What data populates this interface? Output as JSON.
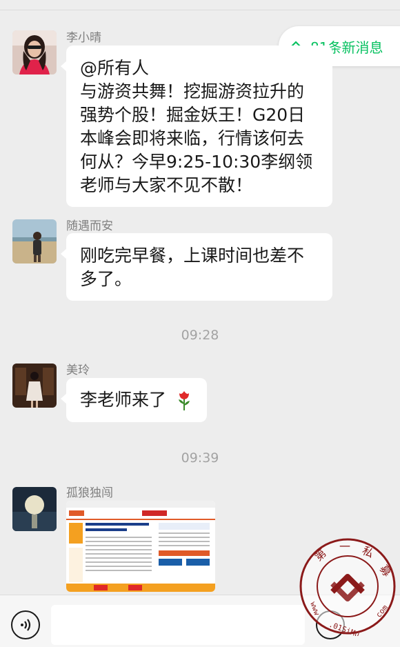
{
  "chat": {
    "new_messages": "81条新消息",
    "messages": [
      {
        "sender": "李小晴",
        "lines": [
          "@所有人",
          "与游资共舞！挖掘游资拉升的",
          "强势个股！掘金妖王！G20日",
          "本峰会即将来临，行情该何去",
          "何从？今早9:25-10:30李纲领",
          "老师与大家不见不散！"
        ]
      },
      {
        "sender": "随遇而安",
        "lines": [
          "刚吃完早餐，上课时间也差不",
          "多了。"
        ]
      },
      {
        "time": "09:28"
      },
      {
        "sender": "美玲",
        "lines": [
          "李老师来了"
        ]
      },
      {
        "time": "09:39"
      },
      {
        "sender": "孤狼独闯",
        "image": "news-webpage-screenshot"
      }
    ]
  },
  "input_bar": {
    "voice_icon": "voice-icon",
    "placeholder": "",
    "emoji_icon": "emoji-icon"
  },
  "watermark": {
    "text": "第一私募 www.01SiMu.com"
  },
  "colors": {
    "background": "#ededed",
    "bubble": "#ffffff",
    "accent_green": "#07c160",
    "meta_text": "#a3a3a3"
  }
}
